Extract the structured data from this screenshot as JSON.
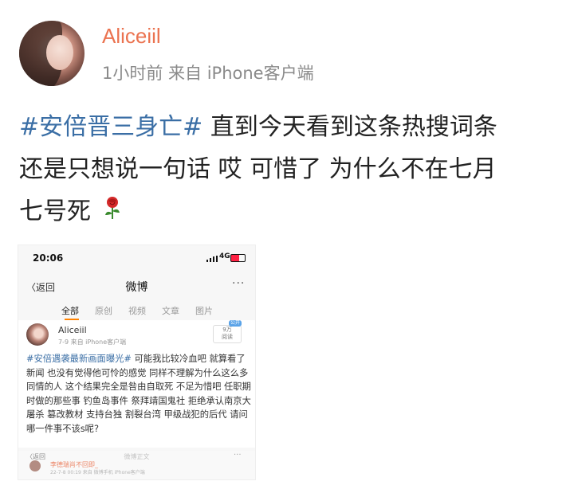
{
  "post": {
    "username": "Aliceiil",
    "meta": "1小时前 来自 iPhone客户端",
    "hashtag": "#安倍晋三身亡#",
    "line1_rest": " 直到今天看到这条热搜词条",
    "line2": "还是只想说一句话 哎 可惜了 为什么不在七月",
    "line3": "七号死",
    "emoji_icon": "rose-icon"
  },
  "screenshot": {
    "status": {
      "time": "20:06",
      "network": "4G"
    },
    "nav": {
      "back": "〈返回",
      "title": "微博",
      "more": "···"
    },
    "tabs": [
      "全部",
      "原创",
      "视频",
      "文章",
      "图片"
    ],
    "card": {
      "name": "Aliceiil",
      "meta": "7-9  来自 iPhone客户端",
      "reads_count": "9万",
      "reads_label": "阅读",
      "reads_badge": "公开",
      "hashtag": "#安倍遇袭最新画面曝光#",
      "text_after_hashtag": " 可能我比较冷血吧 就算看了新闻 也没有觉得他可怜的感觉 同样不理解为什么这么多同情的人 这个结果完全是咎由自取死 不足为惜吧 任职期时做的那些事 钓鱼岛事件 祭拜靖国鬼社 拒绝承认南京大屠杀 篡改教材 支持台独 割裂台湾 甲级战犯的后代 请问哪一件事不该s呢?"
    },
    "bottom": {
      "back": "〈返回",
      "title": "微博正文",
      "more": "···",
      "mini_name": "李德瑞肖不回即_",
      "mini_meta": "22-7-8 00:19  来自 微博手机 iPhone客户端"
    }
  }
}
